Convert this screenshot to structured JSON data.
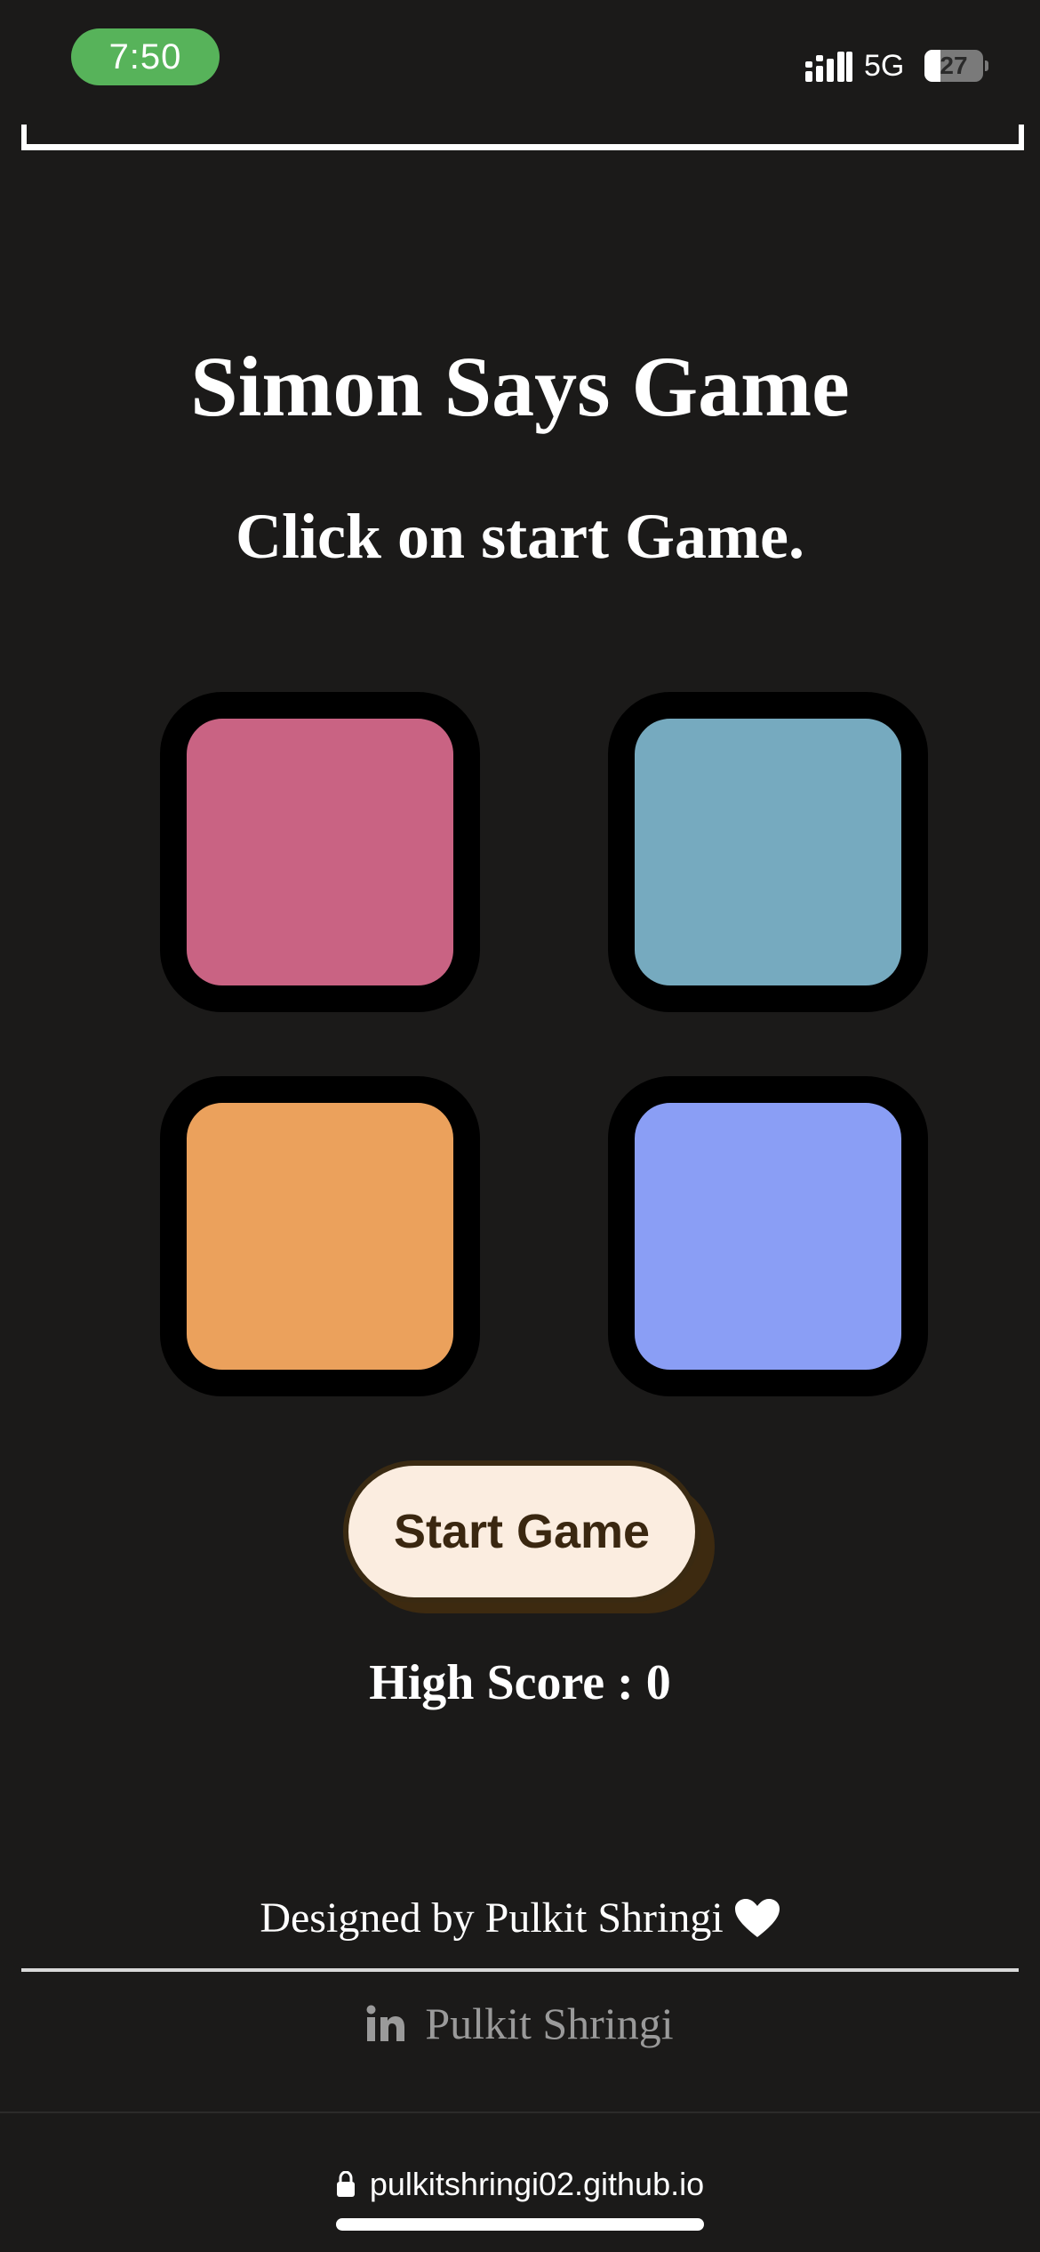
{
  "status_bar": {
    "time": "7:50",
    "network": "5G",
    "battery_level": 27,
    "battery_label": "27",
    "signal_icon": "cellular-signal-icon",
    "battery_icon": "battery-icon"
  },
  "game": {
    "title": "Simon Says Game",
    "status_message": "Click on start Game.",
    "pads": [
      {
        "name": "red",
        "color": "#c96383"
      },
      {
        "name": "teal",
        "color": "#76aabf"
      },
      {
        "name": "orange",
        "color": "#eba15c"
      },
      {
        "name": "blue",
        "color": "#8a9ef5"
      }
    ],
    "start_button_label": "Start Game",
    "high_score_label": "High Score : ",
    "high_score_value": "0"
  },
  "footer": {
    "designed_by": "Designed by Pulkit Shringi",
    "heart_icon": "heart-icon",
    "linkedin_icon": "linkedin-icon",
    "linkedin_label": "Pulkit Shringi"
  },
  "browser": {
    "url": "pulkitshringi02.github.io",
    "lock_icon": "lock-icon"
  },
  "colors": {
    "background": "#1b1a19",
    "time_pill": "#57b35a",
    "start_button_bg": "#fbede0",
    "start_button_text": "#3a2710"
  }
}
